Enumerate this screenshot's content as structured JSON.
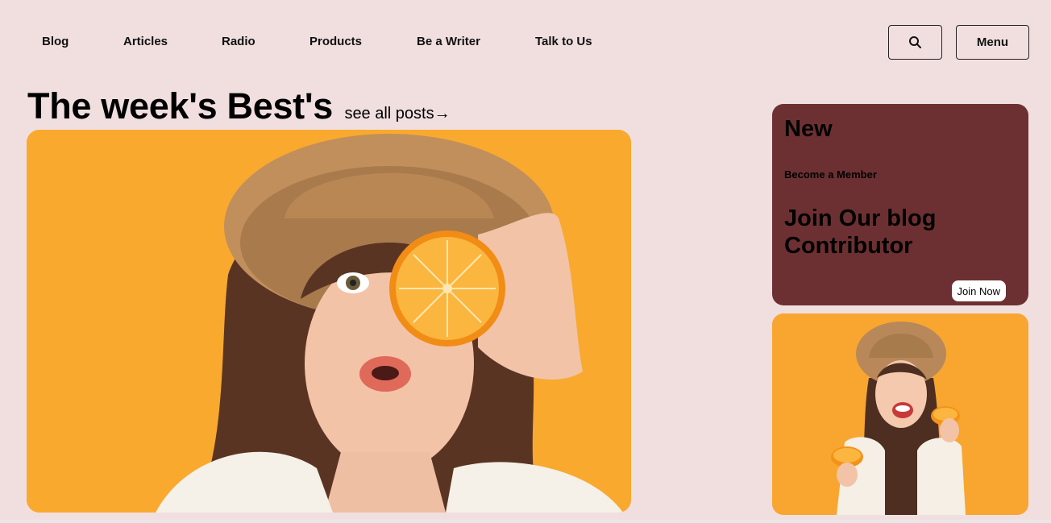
{
  "nav": {
    "items": [
      {
        "label": "Blog"
      },
      {
        "label": "Articles"
      },
      {
        "label": "Radio"
      },
      {
        "label": "Products"
      },
      {
        "label": "Be a Writer"
      },
      {
        "label": "Talk to Us"
      }
    ],
    "search_icon": "search-icon",
    "menu_label": "Menu"
  },
  "main": {
    "heading": "The week's Best's",
    "see_all": "see all posts→",
    "hero_image": "woman-holding-orange-slice-over-eye"
  },
  "promo": {
    "badge": "New",
    "subtitle": "Become a Member",
    "title": "Join Our blog Contributor",
    "button": "Join Now",
    "color": "#6d3032"
  },
  "thumbnail": {
    "image": "smiling-woman-holding-orange-halves"
  },
  "colors": {
    "background": "#f1dfe0",
    "accent_orange": "#f9a92e"
  }
}
